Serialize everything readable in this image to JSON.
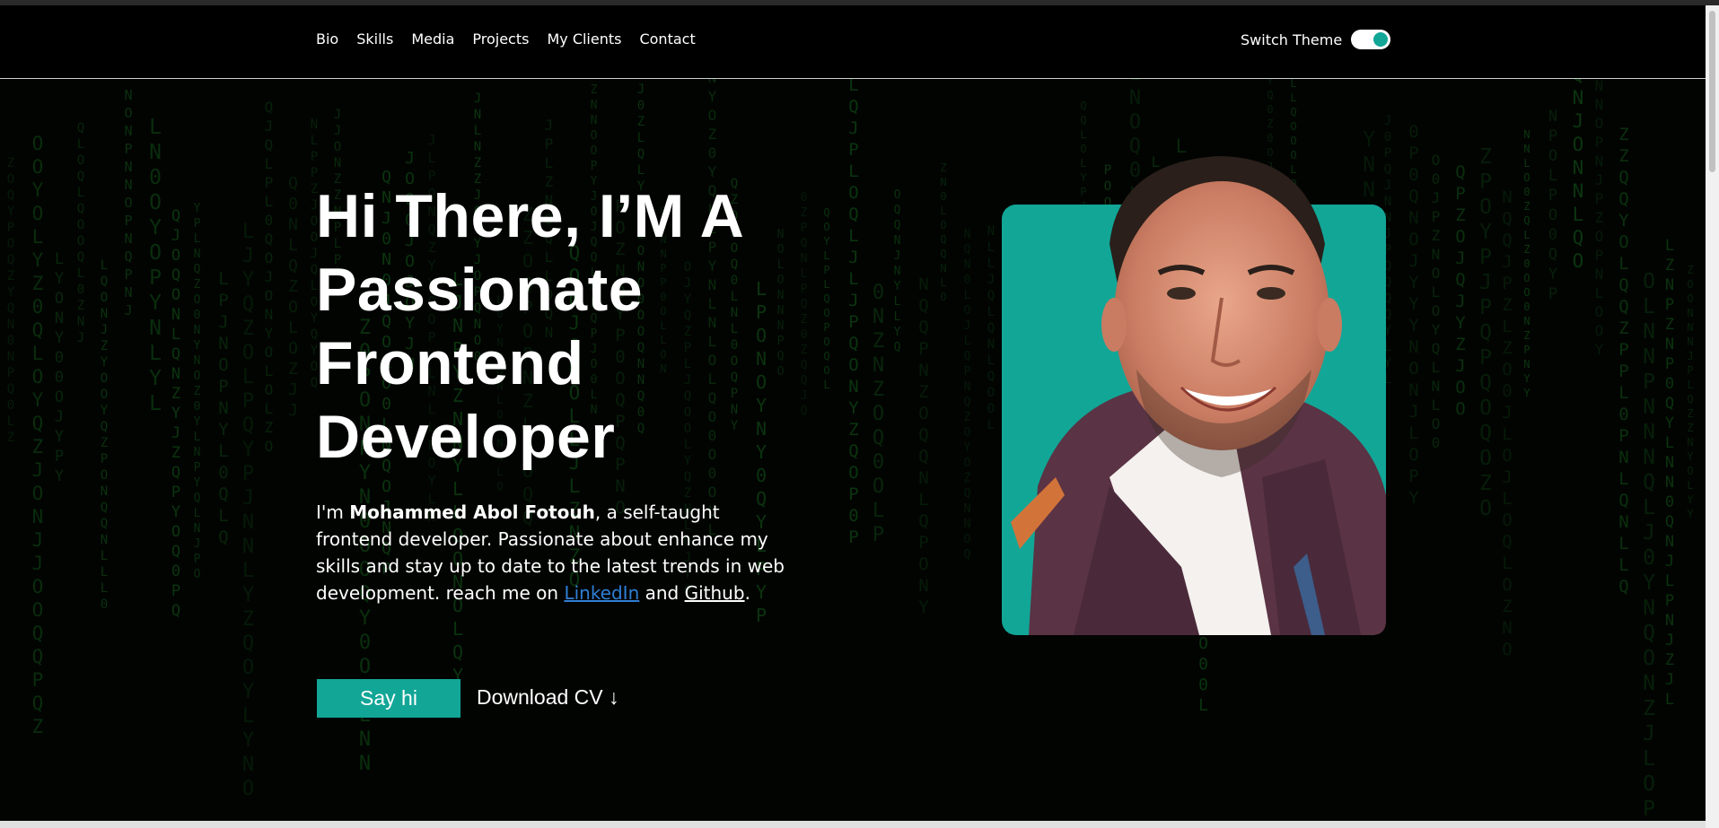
{
  "nav": {
    "items": [
      "Bio",
      "Skills",
      "Media",
      "Projects",
      "My Clients",
      "Contact"
    ],
    "theme_label": "Switch Theme",
    "theme_toggle_on": true
  },
  "hero": {
    "headline": "Hi There, I’M A Passionate Frontend Developer",
    "intro_prefix": "I'm ",
    "intro_name": "Mohammed Abol Fotouh",
    "intro_middle": ", a self-taught frontend developer. Passionate about enhance my skills and stay up to date to the latest trends in web development. reach me on ",
    "linkedin_label": "LinkedIn",
    "intro_and": " and ",
    "github_label": "Github",
    "intro_end": ".",
    "say_hi_label": "Say hi",
    "download_label": "Download CV ↓"
  },
  "colors": {
    "accent": "#12a697",
    "background": "#000000",
    "link": "#2f7fd6",
    "matrix_glyph": "#0d3f12"
  },
  "icons": [
    "toggle-switch-icon",
    "portrait-photo"
  ]
}
